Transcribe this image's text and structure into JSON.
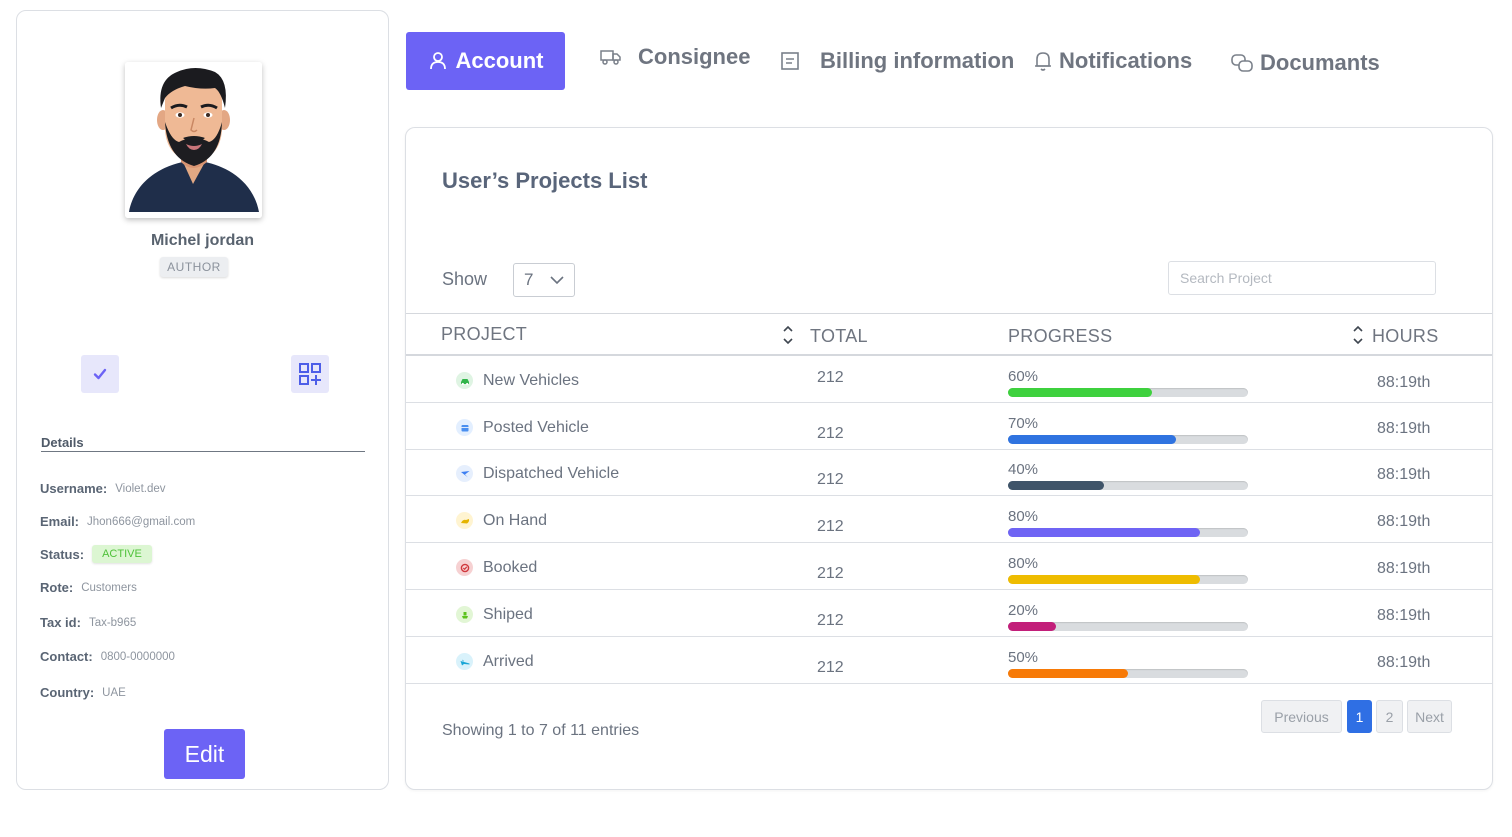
{
  "profile": {
    "name": "Michel jordan",
    "role": "AUTHOR",
    "details_title": "Details",
    "details": [
      {
        "key": "Username:",
        "value": "Violet.dev"
      },
      {
        "key": "Email:",
        "value": "Jhon666@gmail.com"
      },
      {
        "key": "Status:",
        "value": "ACTIVE"
      },
      {
        "key": "Rote:",
        "value": "Customers"
      },
      {
        "key": "Tax id:",
        "value": "Tax-b965"
      },
      {
        "key": "Contact:",
        "value": "0800-0000000"
      },
      {
        "key": "Country:",
        "value": "UAE"
      }
    ],
    "edit_label": "Edit"
  },
  "tabs": [
    {
      "label": "Account",
      "icon": "user-icon",
      "active": true
    },
    {
      "label": "Consignee",
      "icon": "truck-icon"
    },
    {
      "label": "Billing information",
      "icon": "document-icon"
    },
    {
      "label": "Notifications",
      "icon": "bell-icon"
    },
    {
      "label": "Documants",
      "icon": "link-icon"
    }
  ],
  "projects": {
    "title": "User’s Projects List",
    "show_label": "Show",
    "show_value": "7",
    "search_placeholder": "Search Project",
    "columns": {
      "project": "PROJECT",
      "total": "TOTAL",
      "progress": "PROGRESS",
      "hours": "HOURS"
    },
    "rows": [
      {
        "name": "New Vehicles",
        "total": "212",
        "progress": 0.6,
        "progress_label": "60%",
        "color": "#3ed13e",
        "icon": "car-icon",
        "icon_color": "#31b44a",
        "icon_bg": "#dff4e3",
        "hours": "88:19th"
      },
      {
        "name": "Posted Vehicle",
        "total": "212",
        "progress": 0.7,
        "progress_label": "70%",
        "color": "#2f73e0",
        "icon": "calendar-icon",
        "icon_color": "#4a8ff0",
        "icon_bg": "#e3efff",
        "hours": "88:19th"
      },
      {
        "name": "Dispatched Vehicle",
        "total": "212",
        "progress": 0.4,
        "progress_label": "40%",
        "color": "#3f5469",
        "icon": "send-icon",
        "icon_color": "#3d7ff2",
        "icon_bg": "#e6effd",
        "hours": "88:19th"
      },
      {
        "name": "On Hand",
        "total": "212",
        "progress": 0.8,
        "progress_label": "80%",
        "color": "#6f64f4",
        "icon": "hand-icon",
        "icon_color": "#e5b400",
        "icon_bg": "#fff4d1",
        "hours": "88:19th"
      },
      {
        "name": "Booked",
        "total": "212",
        "progress": 0.8,
        "progress_label": "80%",
        "color": "#eebc00",
        "icon": "booked-icon",
        "icon_color": "#d0383d",
        "icon_bg": "#f6d1d2",
        "hours": "88:19th"
      },
      {
        "name": "Shiped",
        "total": "212",
        "progress": 0.2,
        "progress_label": "20%",
        "color": "#c21f7a",
        "icon": "ship-icon",
        "icon_color": "#5cc21d",
        "icon_bg": "#e2f6d5",
        "hours": "88:19th"
      },
      {
        "name": "Arrived",
        "total": "212",
        "progress": 0.5,
        "progress_label": "50%",
        "color": "#f77a07",
        "icon": "plane-icon",
        "icon_color": "#1aa6d6",
        "icon_bg": "#d9f2fb",
        "hours": "88:19th"
      }
    ],
    "entries_text": "Showing 1 to 7 of 11 entries",
    "pagination": {
      "previous": "Previous",
      "pages": [
        "1",
        "2"
      ],
      "current": "1",
      "next": "Next"
    }
  },
  "colors": {
    "accent": "#6c63f5",
    "status_active_bg": "#dcf6d2",
    "status_active_text": "#4fc23a",
    "page_active": "#2f6fe4"
  }
}
